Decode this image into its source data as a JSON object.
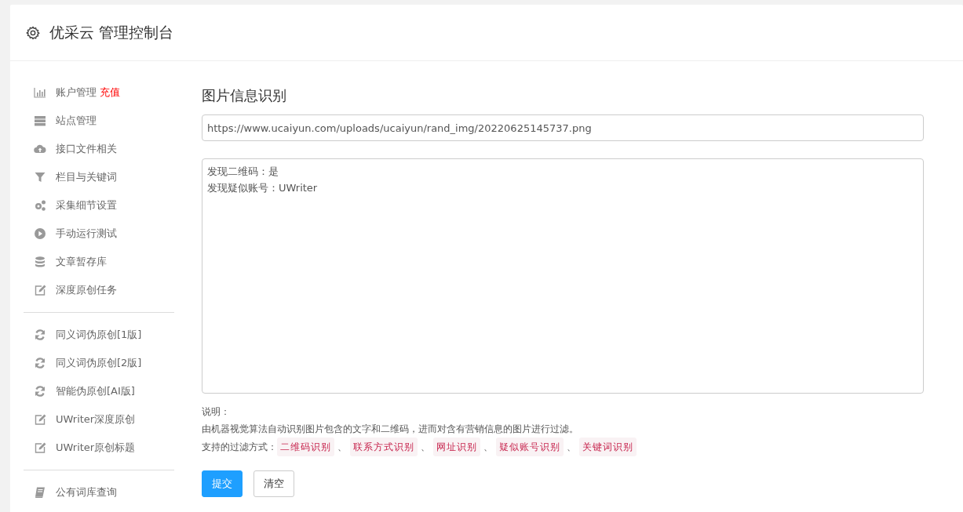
{
  "header": {
    "title": "优采云 管理控制台"
  },
  "sidebar": {
    "groups": [
      {
        "items": [
          {
            "label": "账户管理",
            "badge": "充值"
          },
          {
            "label": "站点管理"
          },
          {
            "label": "接口文件相关"
          },
          {
            "label": "栏目与关键词"
          },
          {
            "label": "采集细节设置"
          },
          {
            "label": "手动运行测试"
          },
          {
            "label": "文章暂存库"
          },
          {
            "label": "深度原创任务"
          }
        ]
      },
      {
        "items": [
          {
            "label": "同义词伪原创[1版]"
          },
          {
            "label": "同义词伪原创[2版]"
          },
          {
            "label": "智能伪原创[AI版]"
          },
          {
            "label": "UWriter深度原创"
          },
          {
            "label": "UWriter原创标题"
          }
        ]
      },
      {
        "items": [
          {
            "label": "公有词库查询"
          }
        ]
      }
    ]
  },
  "main": {
    "heading": "图片信息识别",
    "url_field": {
      "value": "https://www.ucaiyun.com/uploads/ucaiyun/rand_img/20220625145737.png"
    },
    "result_box": {
      "lines": [
        "发现二维码：是",
        "发现疑似账号：UWriter"
      ]
    },
    "note_title": "说明：",
    "note_text": "由机器视觉算法自动识别图片包含的文字和二维码，进而对含有营销信息的图片进行过滤。",
    "filters_label": "支持的过滤方式：",
    "filters": [
      {
        "text": "二维码识别",
        "sep": "、"
      },
      {
        "text": "联系方式识别",
        "sep": "、"
      },
      {
        "text": "网址识别",
        "sep": "、"
      },
      {
        "text": "疑似账号识别",
        "sep": "、"
      },
      {
        "text": "关键词识别"
      }
    ],
    "buttons": [
      {
        "label": "提交",
        "kind": "primary"
      },
      {
        "label": "清空",
        "kind": "default"
      }
    ]
  }
}
